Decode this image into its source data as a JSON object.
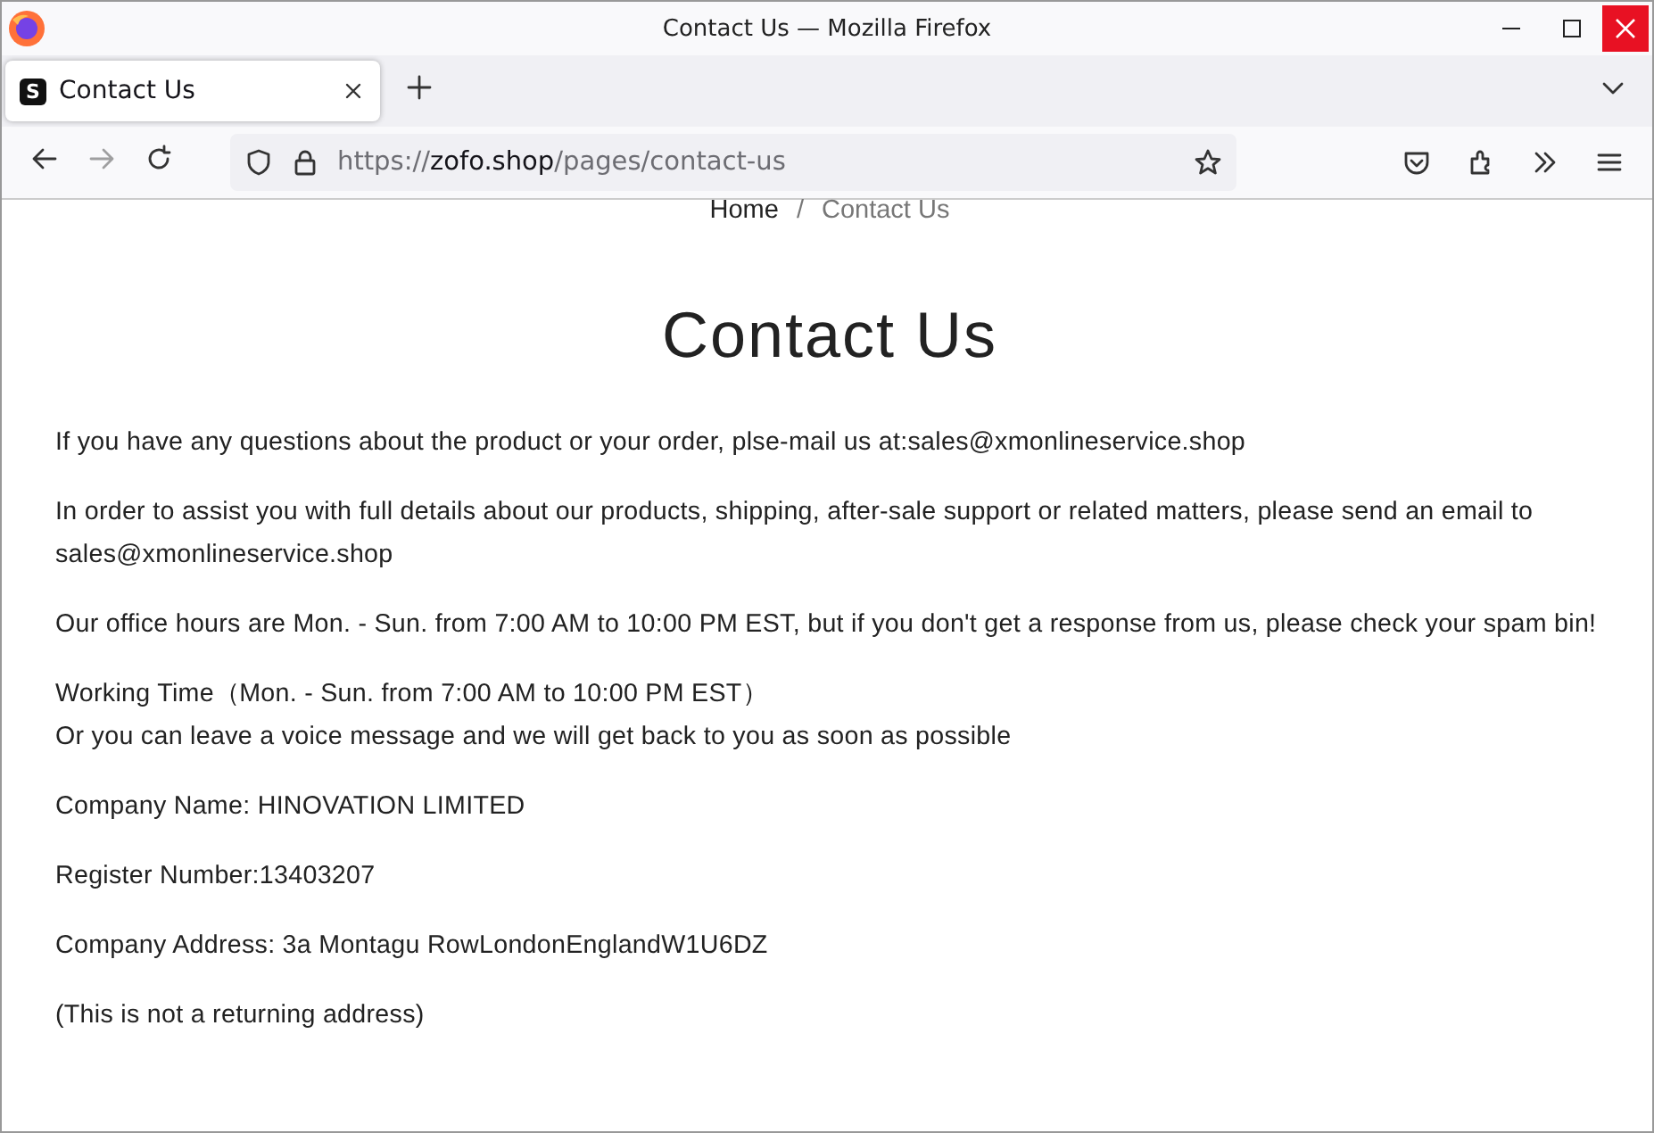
{
  "window": {
    "title": "Contact Us — Mozilla Firefox"
  },
  "tabs": [
    {
      "label": "Contact Us",
      "favicon": "S",
      "selected": true
    }
  ],
  "address_bar": {
    "scheme": "https://",
    "host": "zofo.shop",
    "path": "/pages/contact-us"
  },
  "breadcrumb": [
    {
      "label": "Home",
      "current": false
    },
    {
      "label": "Contact Us",
      "current": true
    }
  ],
  "breadcrumb_separator": "/",
  "heading": "Contact Us",
  "paragraphs": [
    {
      "lines": [
        "If you have any questions about the product or your order, plse-mail us at:sales@xmonlineservice.shop"
      ]
    },
    {
      "lines": [
        "In order to assist you with full details about our products, shipping, after-sale support or related matters, please send an email to sales@xmonlineservice.shop"
      ]
    },
    {
      "lines": [
        "Our office hours are Mon. - Sun. from 7:00 AM to 10:00 PM EST, but if you don't get a response from us, please check your spam bin!"
      ]
    },
    {
      "lines": [
        "Working Time（Mon. - Sun. from 7:00 AM to 10:00 PM EST）",
        "Or you can leave a voice message and we will get back to you as soon as possible"
      ]
    },
    {
      "lines": [
        "Company Name: HINOVATION LIMITED"
      ]
    },
    {
      "lines": [
        "Register Number:13403207"
      ]
    },
    {
      "lines": [
        "Company Address: 3a Montagu RowLondonEnglandW1U6DZ"
      ]
    },
    {
      "lines": [
        "(This is not a returning address)"
      ]
    }
  ]
}
